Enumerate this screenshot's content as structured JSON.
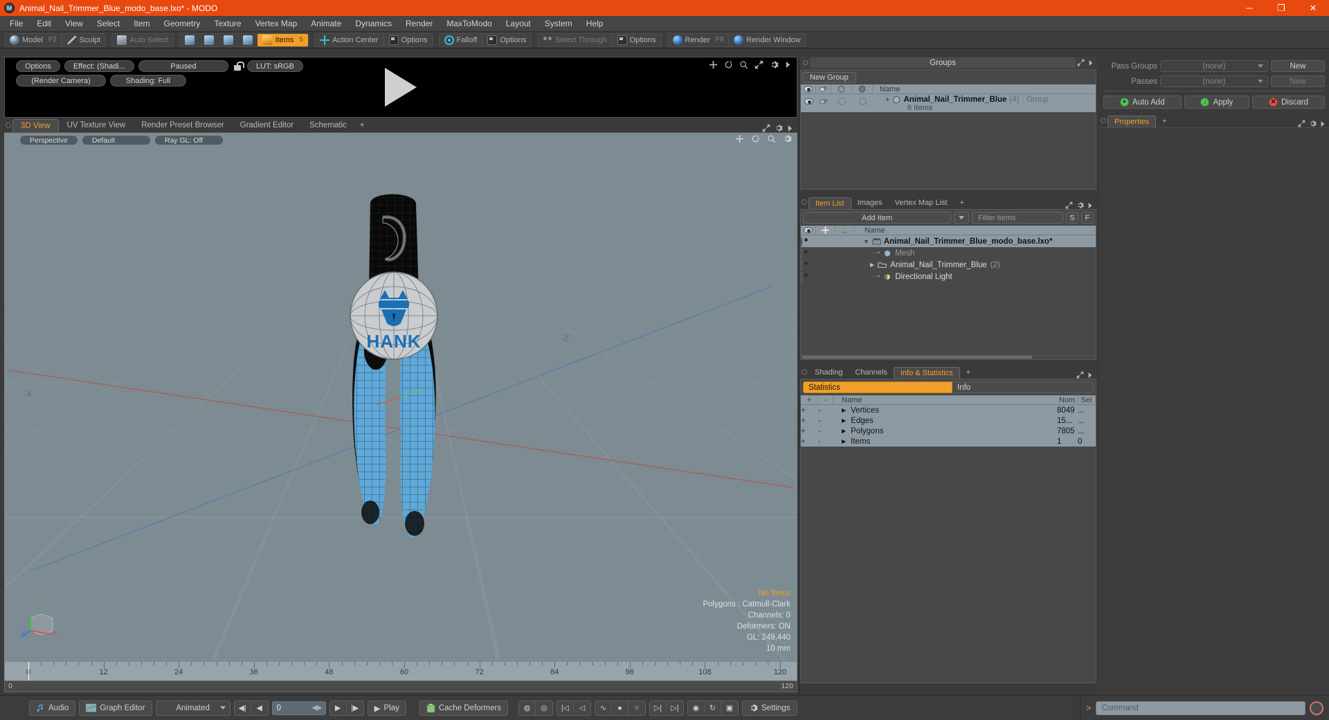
{
  "window": {
    "title": "Animal_Nail_Trimmer_Blue_modo_base.lxo* - MODO",
    "logo": "modo-logo",
    "minimize": "─",
    "maximize": "❐",
    "close": "✕"
  },
  "menu": {
    "items": [
      "File",
      "Edit",
      "View",
      "Select",
      "Item",
      "Geometry",
      "Texture",
      "Vertex Map",
      "Animate",
      "Dynamics",
      "Render",
      "MaxToModo",
      "Layout",
      "System",
      "Help"
    ]
  },
  "modebar": {
    "model": "Model",
    "model_key": "F2",
    "sculpt": "Sculpt",
    "auto_select": "Auto Select",
    "items": "Items",
    "items_key": "5",
    "action_center": "Action Center",
    "options1": "Options",
    "falloff": "Falloff",
    "options2": "Options",
    "select_through": "Select Through",
    "options3": "Options",
    "render": "Render",
    "render_key": "F9",
    "render_window": "Render Window"
  },
  "preview": {
    "options": "Options",
    "effect": "Effect: (Shadi...",
    "paused": "Paused",
    "lock": "unlock-icon",
    "lut": "LUT: sRGB",
    "camera": "(Render Camera)",
    "shading": "Shading: Full",
    "tools": [
      "move-icon",
      "refresh-icon",
      "zoom-icon",
      "expand-icon",
      "gear-icon",
      "arrow-right-icon"
    ]
  },
  "viewport_tabs": {
    "tabs": [
      "3D View",
      "UV Texture View",
      "Render Preset Browser",
      "Gradient Editor",
      "Schematic"
    ],
    "active": "3D View",
    "add": "+",
    "actions": [
      "expand-icon",
      "gear-icon",
      "arrow-right-icon"
    ]
  },
  "viewport": {
    "perspective": "Perspective",
    "shading_preset": "Default",
    "raygl": "Ray GL: Off",
    "tools": [
      "move-icon",
      "refresh-icon",
      "zoom-icon",
      "gear-icon"
    ],
    "axis_labels": {
      "x": "-X",
      "z": "-Z"
    },
    "widget_axes": {
      "x": "X",
      "y": "Y",
      "z": "Z"
    },
    "info": {
      "selection": "No Items",
      "polygons": "Polygons : Catmull-Clark",
      "channels": "Channels: 0",
      "deformers": "Deformers: ON",
      "gl": "GL: 249,440",
      "units": "10 mm"
    }
  },
  "timeline": {
    "major_ticks": [
      0,
      12,
      24,
      36,
      48,
      60,
      72,
      84,
      96,
      108,
      120
    ],
    "start": "0",
    "end": "120",
    "range_left": "0",
    "range_right": "120",
    "playhead_frame": 0
  },
  "bottombar": {
    "audio": "Audio",
    "graph_editor": "Graph Editor",
    "mode": "Animated",
    "frame_value": "0",
    "play": "Play",
    "cache_deformers": "Cache Deformers",
    "settings": "Settings",
    "transport": {
      "first": "⏮",
      "prev": "◁",
      "next": "▷",
      "last": "⏭"
    }
  },
  "groups_panel": {
    "title": "Groups",
    "new_group": "New Group",
    "columns": [
      "eye-icon",
      "render-icon",
      "shape-a-icon",
      "shape-b-icon",
      "Name"
    ],
    "rows": [
      {
        "name": "Animal_Nail_Trimmer_Blue",
        "count": "(4)",
        "type": ": Group",
        "sub": "6 Items",
        "expander": "+"
      }
    ]
  },
  "item_list_panel": {
    "tabs": [
      "Item List",
      "Images",
      "Vertex Map List"
    ],
    "active": "Item List",
    "add": "+",
    "add_item": "Add Item",
    "filter_placeholder": "Filter Items",
    "btn_s": "S",
    "btn_f": "F",
    "columns": [
      "eye-icon",
      "lock-icon",
      "axis-icon",
      "Name"
    ],
    "rows": [
      {
        "name": "Animal_Nail_Trimmer_Blue_modo_base.lxo*",
        "icon": "scene-icon",
        "indent": 0,
        "expander": "▼",
        "suffix": ""
      },
      {
        "name": "Mesh",
        "icon": "mesh-icon",
        "indent": 1,
        "expander": "",
        "suffix": "",
        "dim": true
      },
      {
        "name": "Animal_Nail_Trimmer_Blue",
        "icon": "folder-icon",
        "indent": 1,
        "expander": "▶",
        "suffix": "(2)"
      },
      {
        "name": "Directional Light",
        "icon": "light-icon",
        "indent": 1,
        "expander": "",
        "suffix": ""
      }
    ]
  },
  "stats_panel": {
    "tabs": [
      "Shading",
      "Channels",
      "Info & Statistics"
    ],
    "active": "Info & Statistics",
    "add": "+",
    "mode_statistics": "Statistics",
    "mode_info": "Info",
    "columns": [
      "+",
      "-",
      "Name",
      "Num",
      "Sel"
    ],
    "rows": [
      {
        "name": "Vertices",
        "num": "8049",
        "sel": "..."
      },
      {
        "name": "Edges",
        "num": "15...",
        "sel": "..."
      },
      {
        "name": "Polygons",
        "num": "7805",
        "sel": "..."
      },
      {
        "name": "Items",
        "num": "1",
        "sel": "0"
      }
    ]
  },
  "properties_panel": {
    "pass_groups_label": "Pass Groups",
    "pass_groups_value": "(none)",
    "pass_groups_new": "New",
    "passes_label": "Passes",
    "passes_value": "(none)",
    "passes_new": "New",
    "auto_add": "Auto Add",
    "apply": "Apply",
    "discard": "Discard",
    "tab": "Properties",
    "add": "+",
    "actions": [
      "expand-icon",
      "gear-icon",
      "arrow-right-icon"
    ]
  },
  "command_bar": {
    "chevron": ">",
    "placeholder": "Command",
    "record": "record-icon"
  },
  "colors": {
    "title_bar": "#e8490f",
    "accent": "#f0a02a",
    "panel_bg": "#3c3c3c",
    "viewport_bg": "#7d8b93",
    "mesh_blue": "#5fa8d8",
    "mesh_black": "#0b0b0b"
  }
}
